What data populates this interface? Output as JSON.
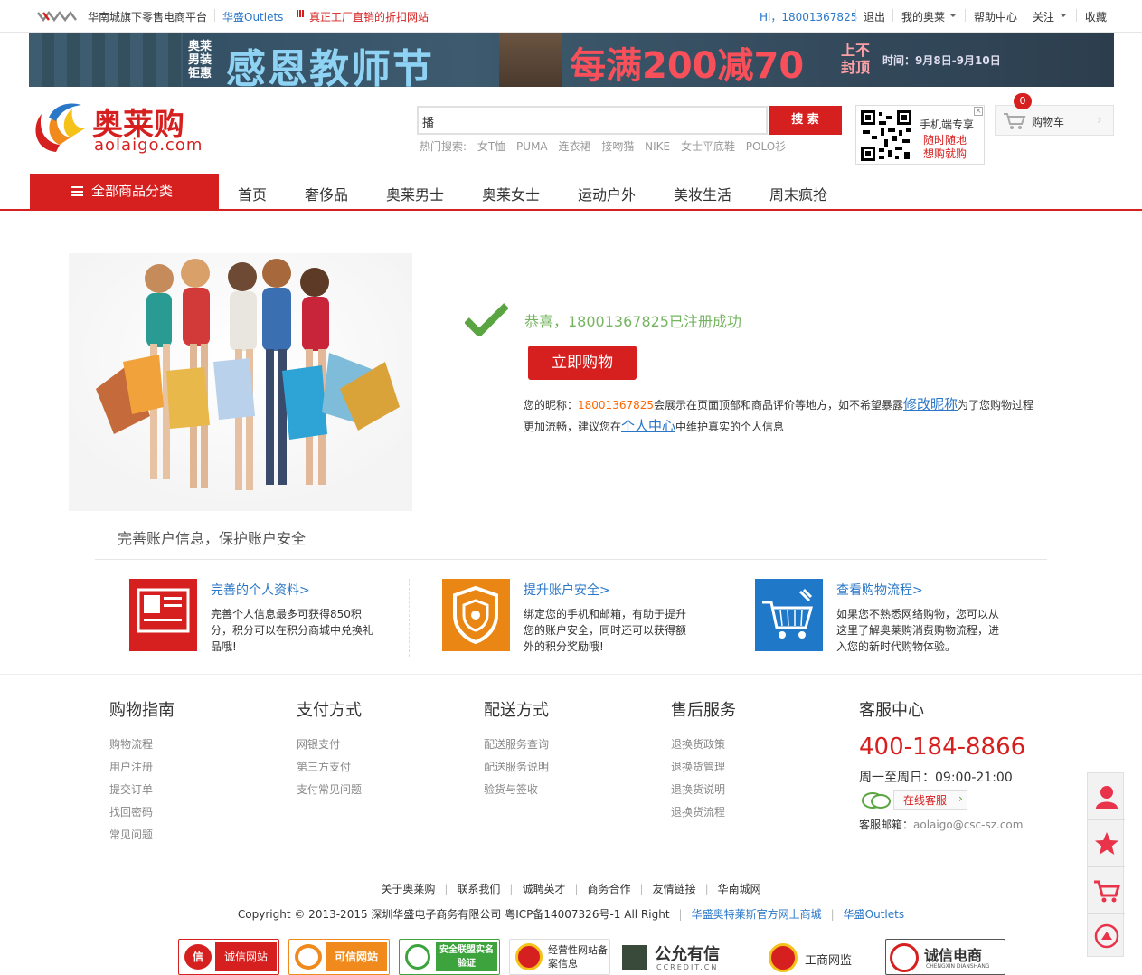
{
  "topbar": {
    "platform": "华南城旗下零售电商平台",
    "outlets": "华盛Outlets",
    "factory": "真正工厂直销的折扣网站",
    "greeting": "Hi，18001367825",
    "logout": "退出",
    "my_account": "我的奥莱",
    "help": "帮助中心",
    "follow": "关注",
    "favorite": "收藏"
  },
  "banner": {
    "brand": "奥莱男装钜惠",
    "title": "感恩教师节",
    "promo": "每满200减70",
    "cap": "上不封顶",
    "date": "时间：9月8日-9月10日"
  },
  "logo": {
    "name": "奥莱购",
    "domain": "aolaigo.com"
  },
  "search": {
    "value": "播",
    "button": "搜 索",
    "hot_label": "热门搜索:",
    "hot": [
      "女T恤",
      "PUMA",
      "连衣裙",
      "接吻猫",
      "NIKE",
      "女士平底鞋",
      "POLO衫"
    ]
  },
  "qr": {
    "line1": "手机端专享",
    "line2": "随时随地",
    "line3": "想购就购"
  },
  "cart": {
    "label": "购物车",
    "count": "0"
  },
  "nav": {
    "all": "全部商品分类",
    "items": [
      "首页",
      "奢侈品",
      "奥莱男士",
      "奥莱女士",
      "运动户外",
      "美妆生活",
      "周末疯抢"
    ]
  },
  "success": {
    "message": "恭喜，18001367825已注册成功",
    "button": "立即购物",
    "line1_a": "您的昵称：",
    "nickname": "18001367825",
    "line1_b": "会展示在页面顶部和商品评价等地方，如不希望暴露",
    "edit_link": "修改昵称",
    "line1_c": "为了您购物过程",
    "line2_a": "更加流畅，建议您在",
    "center_link": "个人中心",
    "line2_b": "中维护真实的个人信息"
  },
  "section_title": "完善账户信息，保护账户安全",
  "cards": [
    {
      "title": "完善的个人资料>",
      "desc": "完善个人信息最多可获得850积分，积分可以在积分商城中兑换礼品哦!"
    },
    {
      "title": "提升账户安全>",
      "desc": "绑定您的手机和邮箱，有助于提升您的账户安全，同时还可以获得额外的积分奖励哦!"
    },
    {
      "title": "查看购物流程>",
      "desc": "如果您不熟悉网络购物，您可以从这里了解奥莱购消费购物流程，进入您的新时代购物体验。"
    }
  ],
  "footer": {
    "columns": [
      {
        "title": "购物指南",
        "items": [
          "购物流程",
          "用户注册",
          "提交订单",
          "找回密码",
          "常见问题"
        ]
      },
      {
        "title": "支付方式",
        "items": [
          "网银支付",
          "第三方支付",
          "支付常见问题"
        ]
      },
      {
        "title": "配送方式",
        "items": [
          "配送服务查询",
          "配送服务说明",
          "验货与签收"
        ]
      },
      {
        "title": "售后服务",
        "items": [
          "退换货政策",
          "退换货管理",
          "退换货说明",
          "退换货流程"
        ]
      }
    ],
    "service": {
      "title": "客服中心",
      "phone": "400-184-8866",
      "hours": "周一至周日：09:00-21:00",
      "online": "在线客服",
      "email_label": "客服邮箱：",
      "email": "aolaigo@csc-sz.com"
    }
  },
  "links": {
    "items": [
      "关于奥莱购",
      "联系我们",
      "诚聘英才",
      "商务合作",
      "友情链接",
      "华南城网"
    ],
    "copyright": "Copyright © 2013-2015 深圳华盛电子商务有限公司 粤ICP备14007326号-1 All Right",
    "mall": "华盛奥特莱斯官方网上商城",
    "outlets": "华盛Outlets"
  },
  "badges": [
    "诚信网站",
    "可信网站",
    "安全联盟实名验证",
    "经营性网站备案信息",
    "公允有信",
    "工商网监",
    "诚信电商"
  ],
  "badge_sub": {
    "ccredit": "CCREDIT.CN",
    "chengxin": "CHENGXIN DIANSHANG"
  }
}
